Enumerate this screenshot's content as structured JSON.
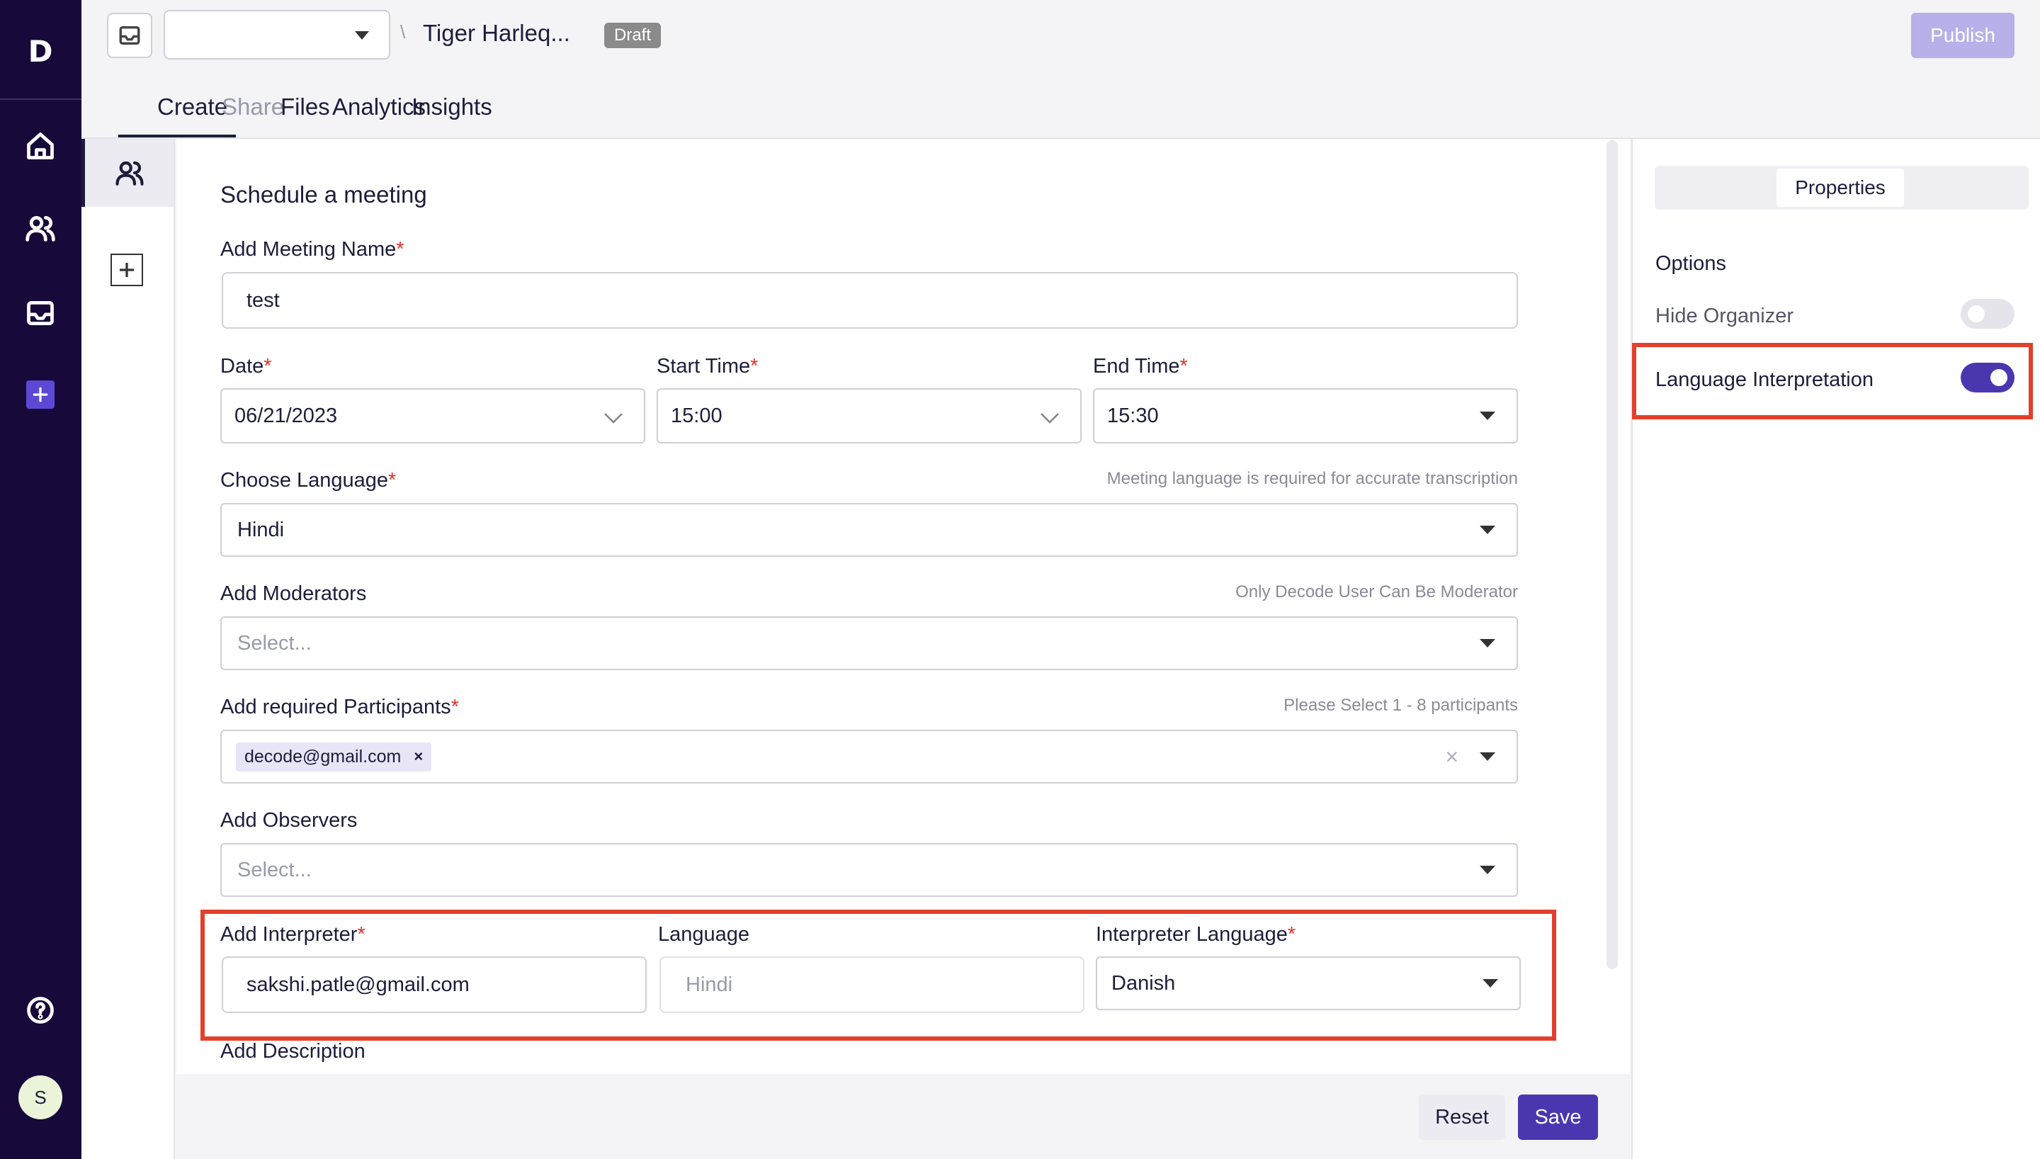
{
  "colors": {
    "rail": "#170a3a",
    "accent": "#4a37b0",
    "highlight": "#e3402c",
    "required": "#e0332b"
  },
  "rail": {
    "logo": "D",
    "icons": [
      "home-icon",
      "users-icon",
      "inbox-icon",
      "plus-square-icon",
      "help-icon"
    ],
    "avatar_initial": "S"
  },
  "header": {
    "project_title": "Tiger Harleq...",
    "status_badge": "Draft",
    "publish_label": "Publish",
    "crumb_sep": "\\"
  },
  "tabs": [
    {
      "label": "Create",
      "active": true
    },
    {
      "label": "Share",
      "muted": true
    },
    {
      "label": "Files"
    },
    {
      "label": "Analytics"
    },
    {
      "label": "Insights"
    }
  ],
  "form": {
    "heading": "Schedule a meeting",
    "meeting_name": {
      "label": "Add Meeting Name",
      "value": "test"
    },
    "date": {
      "label": "Date",
      "value": "06/21/2023"
    },
    "start_time": {
      "label": "Start Time",
      "value": "15:00"
    },
    "end_time": {
      "label": "End Time",
      "value": "15:30"
    },
    "language": {
      "label": "Choose Language",
      "hint": "Meeting language is required for accurate transcription",
      "value": "Hindi"
    },
    "moderators": {
      "label": "Add Moderators",
      "hint": "Only Decode User Can Be Moderator",
      "placeholder": "Select..."
    },
    "participants": {
      "label": "Add required Participants",
      "hint": "Please Select 1 - 8 participants",
      "chips": [
        "decode@gmail.com"
      ]
    },
    "observers": {
      "label": "Add Observers",
      "placeholder": "Select..."
    },
    "interpreter": {
      "label": "Add Interpreter",
      "value": "sakshi.patle@gmail.com"
    },
    "interp_language": {
      "label": "Language",
      "placeholder": "Hindi"
    },
    "interpreter_language": {
      "label": "Interpreter Language",
      "value": "Danish"
    },
    "description": {
      "label": "Add Description"
    },
    "required_mark": "*"
  },
  "footer": {
    "reset_label": "Reset",
    "save_label": "Save"
  },
  "properties": {
    "tab_label": "Properties",
    "options_title": "Options",
    "hide_organizer": {
      "label": "Hide Organizer",
      "enabled": false
    },
    "language_interpretation": {
      "label": "Language Interpretation",
      "enabled": true
    }
  }
}
